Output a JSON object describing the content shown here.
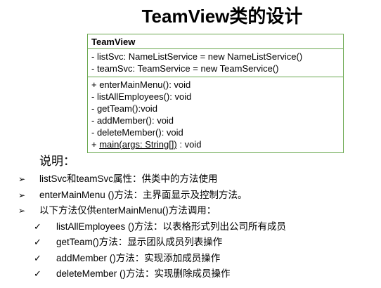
{
  "title": "TeamView类的设计",
  "uml": {
    "class_name": "TeamView",
    "attributes": [
      "- listSvc: NameListService = new NameListService()",
      "- teamSvc: TeamService = new TeamService()"
    ],
    "methods": [
      "+ enterMainMenu(): void",
      "- listAllEmployees(): void",
      "- getTeam():void",
      "- addMember(): void",
      "- deleteMember(): void"
    ],
    "static_method": {
      "prefix": "+ ",
      "underlined": "main(args: String[])",
      "suffix": " : void"
    },
    "border_color": "#6aa84f"
  },
  "explanation": {
    "label": "说明：",
    "items": [
      {
        "level": 1,
        "marker": "➢",
        "text": "listSvc和teamSvc属性：供类中的方法使用"
      },
      {
        "level": 1,
        "marker": "➢",
        "text": "enterMainMenu ()方法：主界面显示及控制方法。"
      },
      {
        "level": 1,
        "marker": "➢",
        "text": "以下方法仅供enterMainMenu()方法调用："
      },
      {
        "level": 2,
        "marker": "✓",
        "text": "listAllEmployees ()方法：以表格形式列出公司所有成员"
      },
      {
        "level": 2,
        "marker": "✓",
        "text": "getTeam()方法：显示团队成员列表操作"
      },
      {
        "level": 2,
        "marker": "✓",
        "text": "addMember ()方法：实现添加成员操作"
      },
      {
        "level": 2,
        "marker": "✓",
        "text": "deleteMember ()方法：实现删除成员操作"
      }
    ]
  }
}
